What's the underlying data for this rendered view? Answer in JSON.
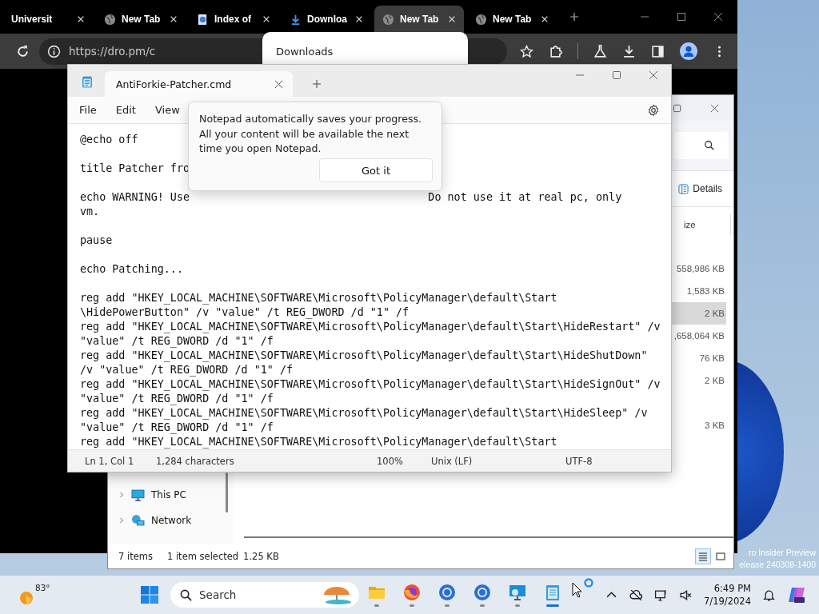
{
  "browser": {
    "tabs": [
      {
        "title": "Universit",
        "kind": "plain",
        "selected": false
      },
      {
        "title": "New Tab",
        "kind": "newtab",
        "selected": false
      },
      {
        "title": "Index of",
        "kind": "page",
        "selected": false
      },
      {
        "title": "Downloa",
        "kind": "download",
        "selected": false
      },
      {
        "title": "New Tab",
        "kind": "newtab",
        "selected": true
      },
      {
        "title": "New Tab",
        "kind": "newtab",
        "selected": false
      }
    ],
    "address": "https://dro.pm/c",
    "downloads_popup": {
      "title": "Downloads"
    }
  },
  "explorer": {
    "view_button": "Details",
    "size_header": "ize",
    "sizes": [
      {
        "text": "558,986 KB",
        "selected": false,
        "gap_before": false
      },
      {
        "text": "1,583 KB",
        "selected": false,
        "gap_before": false
      },
      {
        "text": "2 KB",
        "selected": true,
        "gap_before": false
      },
      {
        "text": ",658,064 KB",
        "selected": false,
        "gap_before": false
      },
      {
        "text": "76 KB",
        "selected": false,
        "gap_before": false
      },
      {
        "text": "2 KB",
        "selected": false,
        "gap_before": false
      },
      {
        "text": "3 KB",
        "selected": false,
        "gap_before": true
      }
    ],
    "nav": [
      {
        "label": "This PC",
        "kind": "pc"
      },
      {
        "label": "Network",
        "kind": "network"
      }
    ],
    "status": {
      "items": "7 items",
      "selection": "1 item selected",
      "size": "1.25 KB"
    }
  },
  "notepad": {
    "tab_title": "AntiForkie-Patcher.cmd",
    "menu": [
      "File",
      "Edit",
      "View"
    ],
    "lines": [
      {
        "text": "@echo off",
        "space_after": true
      },
      {
        "text": "title Patcher fro",
        "space_after": true
      },
      {
        "text": "echo WARNING! Use",
        "text_right": "Do not use it at real pc, only",
        "space_after": false
      },
      {
        "text": "vm.",
        "space_after": true
      },
      {
        "text": "pause",
        "space_after": true
      },
      {
        "text": "echo Patching...",
        "space_after": true
      },
      {
        "text": "reg add \"HKEY_LOCAL_MACHINE\\SOFTWARE\\Microsoft\\PolicyManager\\default\\Start",
        "space_after": false
      },
      {
        "text": "\\HidePowerButton\" /v \"value\" /t REG_DWORD /d \"1\" /f",
        "space_after": false
      },
      {
        "text": "reg add \"HKEY_LOCAL_MACHINE\\SOFTWARE\\Microsoft\\PolicyManager\\default\\Start\\HideRestart\" /v",
        "space_after": false
      },
      {
        "text": "\"value\" /t REG_DWORD /d \"1\" /f",
        "space_after": false
      },
      {
        "text": "reg add \"HKEY_LOCAL_MACHINE\\SOFTWARE\\Microsoft\\PolicyManager\\default\\Start\\HideShutDown\"",
        "space_after": false
      },
      {
        "text": "/v \"value\" /t REG_DWORD /d \"1\" /f",
        "space_after": false
      },
      {
        "text": "reg add \"HKEY_LOCAL_MACHINE\\SOFTWARE\\Microsoft\\PolicyManager\\default\\Start\\HideSignOut\" /v",
        "space_after": false
      },
      {
        "text": "\"value\" /t REG_DWORD /d \"1\" /f",
        "space_after": false
      },
      {
        "text": "reg add \"HKEY_LOCAL_MACHINE\\SOFTWARE\\Microsoft\\PolicyManager\\default\\Start\\HideSleep\" /v",
        "space_after": false
      },
      {
        "text": "\"value\" /t REG_DWORD /d \"1\" /f",
        "space_after": false
      },
      {
        "text": "reg add \"HKEY_LOCAL_MACHINE\\SOFTWARE\\Microsoft\\PolicyManager\\default\\Start",
        "space_after": false
      }
    ],
    "tip": {
      "text": "Notepad automatically saves your progress. All your content will be available the next time you open Notepad.",
      "button": "Got it"
    },
    "status": {
      "position": "Ln 1, Col 1",
      "characters": "1,284 characters",
      "zoom": "100%",
      "line_endings": "Unix (LF)",
      "encoding": "UTF-8"
    }
  },
  "desktop": {
    "watermark": [
      "ro Insider Preview",
      "elease 240308-1400"
    ]
  },
  "taskbar": {
    "weather": "83°",
    "search": {
      "placeholder": "Search"
    },
    "apps": [
      {
        "kind": "folder",
        "active": false
      },
      {
        "kind": "firefox",
        "active": false
      },
      {
        "kind": "chrome",
        "active": false
      },
      {
        "kind": "chrome",
        "active": false
      },
      {
        "kind": "remote",
        "active": false
      },
      {
        "kind": "notepad",
        "active": true
      }
    ],
    "time": "6:49 PM",
    "date": "7/19/2024"
  }
}
